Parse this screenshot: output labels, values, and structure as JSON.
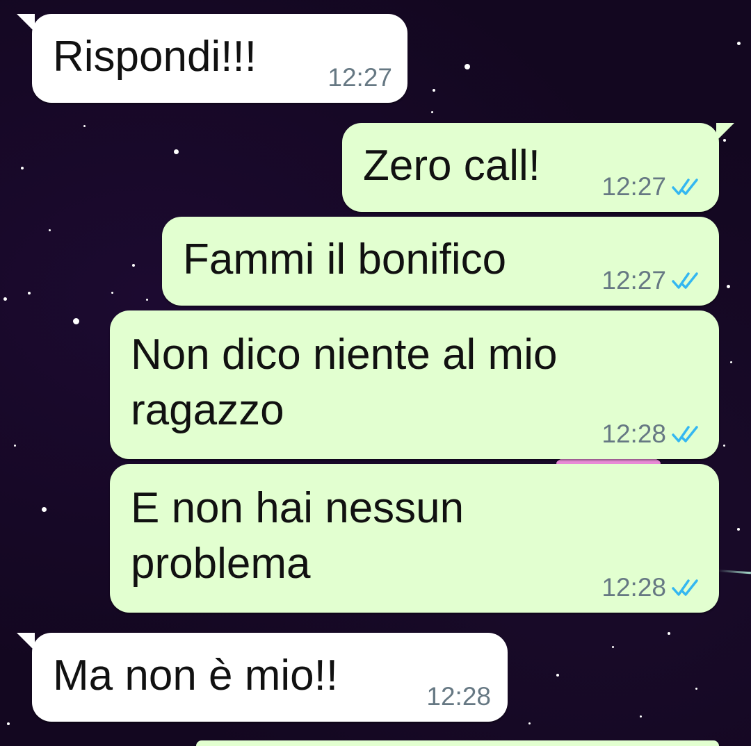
{
  "theme": {
    "incoming_bubble_color": "#ffffff",
    "outgoing_bubble_color": "#e2ffd0",
    "text_color": "#111111",
    "time_color": "#667883",
    "read_tick_color": "#34b7f1"
  },
  "messages": [
    {
      "direction": "incoming",
      "text": "Rispondi!!!",
      "time": "12:27"
    },
    {
      "direction": "outgoing",
      "text": "Zero call!",
      "time": "12:27",
      "status": "read"
    },
    {
      "direction": "outgoing",
      "text": "Fammi il bonifico",
      "time": "12:27",
      "status": "read"
    },
    {
      "direction": "outgoing",
      "text": "Non dico niente al mio\nragazzo",
      "time": "12:28",
      "status": "read"
    },
    {
      "direction": "outgoing",
      "text": "E non hai nessun\nproblema",
      "time": "12:28",
      "status": "read"
    },
    {
      "direction": "incoming",
      "text": "Ma non è mio!!",
      "time": "12:28"
    }
  ],
  "icons": {
    "read_ticks": "double-check-icon"
  }
}
